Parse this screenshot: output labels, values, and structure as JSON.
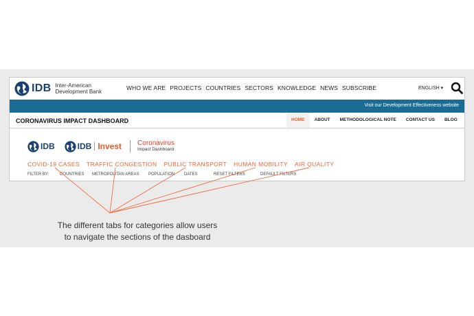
{
  "topnav": {
    "logo_text": "IDB",
    "logo_sub": "Inter-American Development Bank",
    "items": [
      "WHO WE ARE",
      "PROJECTS",
      "COUNTRIES",
      "SECTORS",
      "KNOWLEDGE",
      "NEWS",
      "SUBSCRIBE"
    ],
    "language": "ENGLISH ▾"
  },
  "bluebar": {
    "link": "Visit our Development Effectiveness website"
  },
  "dashboard": {
    "title": "CORONAVIRUS IMPACT DASHBOARD",
    "subnav": [
      "HOME",
      "ABOUT",
      "METHODOLOGICAL NOTE",
      "CONTACT US",
      "BLOG"
    ],
    "active_subnav": "HOME"
  },
  "brands": {
    "idb": "IDB",
    "invest_idb": "IDB",
    "invest": "Invest",
    "coronavirus": "Coronavirus",
    "impact_dashboard": "Impact Dashboard"
  },
  "categories": [
    "COVID-19 CASES",
    "TRAFFIC CONGESTION",
    "PUBLIC TRANSPORT",
    "HUMAN MOBILITY",
    "AIR QUALITY"
  ],
  "filters": {
    "label": "FILTER BY:",
    "items": [
      "COUNTRIES",
      "METROPOLITAN AREAS",
      "POPULATION",
      "DATES",
      "RESET FILTERS",
      "DEFAULT FILTERS"
    ]
  },
  "caption": {
    "line1": "The different tabs for categories allow users",
    "line2": "to navigate the sections of the dasboard"
  },
  "colors": {
    "brand_blue": "#1c3f72",
    "bar_blue": "#1a6c94",
    "accent_orange": "#f26430",
    "coronavirus_red": "#e23b2a"
  }
}
